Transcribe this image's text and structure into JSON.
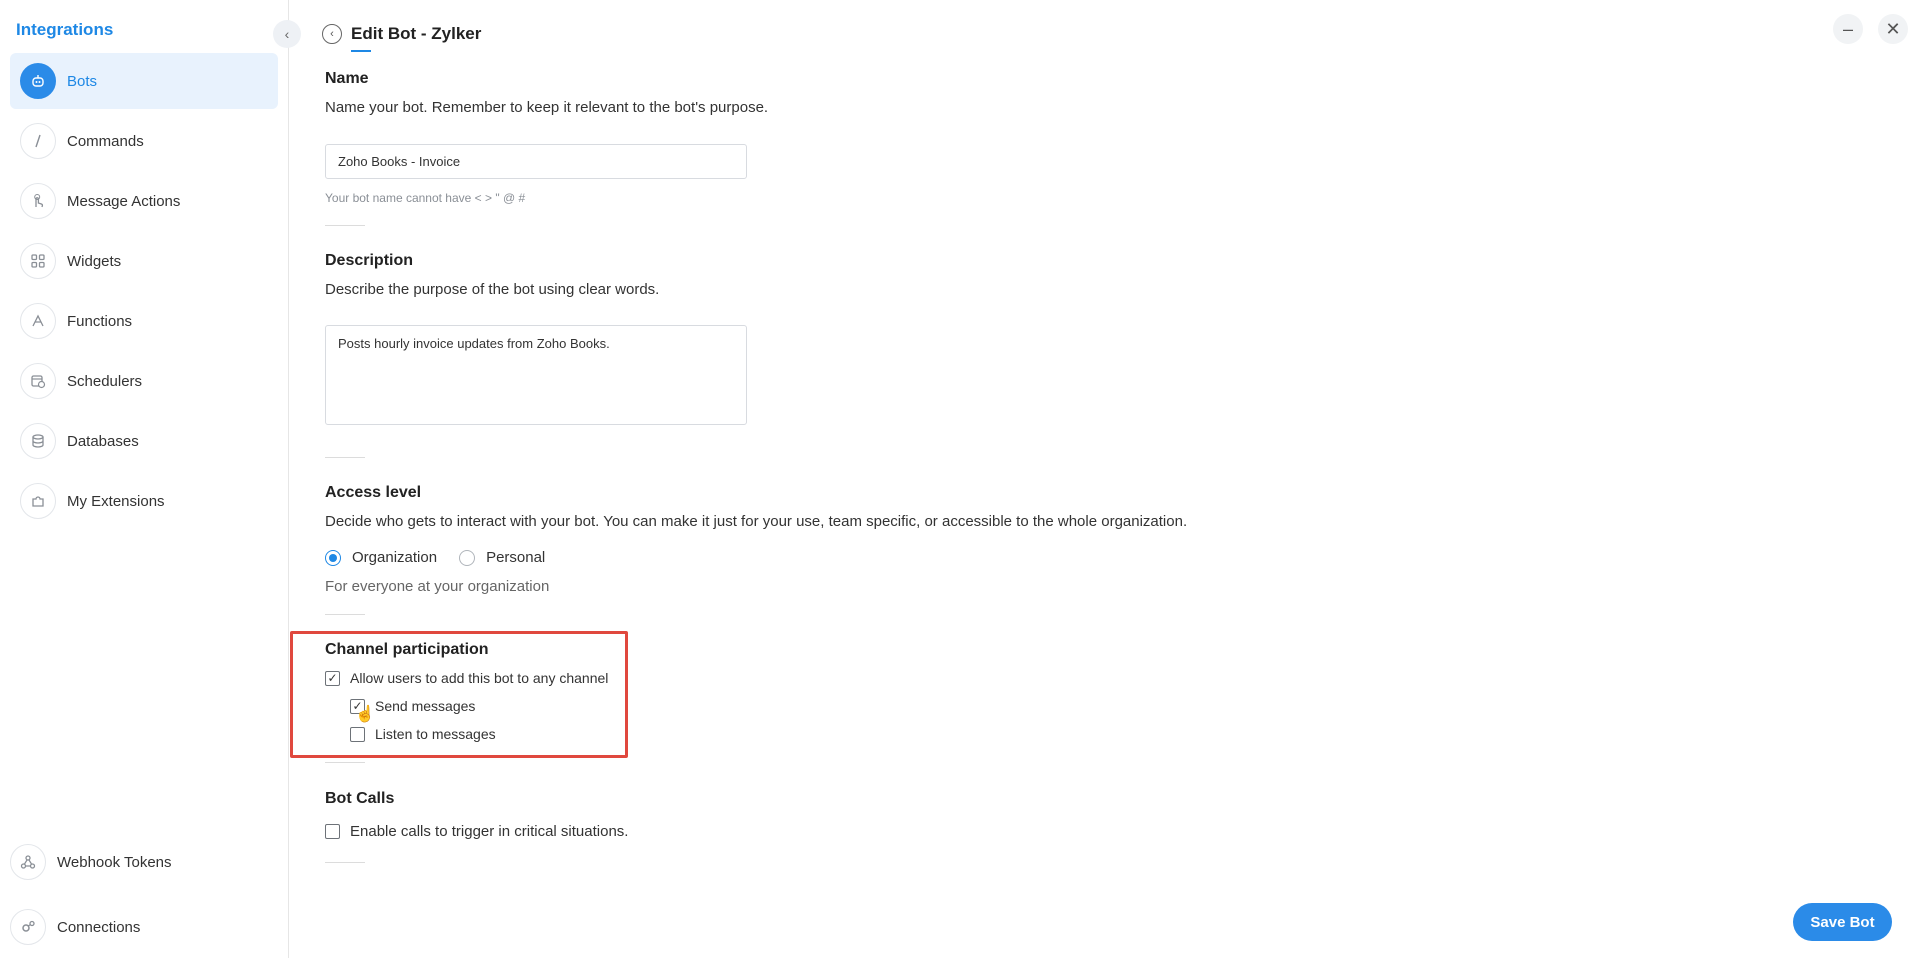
{
  "sidebar": {
    "title": "Integrations",
    "items": [
      {
        "label": "Bots",
        "icon": "bot-icon"
      },
      {
        "label": "Commands",
        "icon": "slash-icon"
      },
      {
        "label": "Message Actions",
        "icon": "touch-icon"
      },
      {
        "label": "Widgets",
        "icon": "grid-icon"
      },
      {
        "label": "Functions",
        "icon": "function-icon"
      },
      {
        "label": "Schedulers",
        "icon": "scheduler-icon"
      },
      {
        "label": "Databases",
        "icon": "database-icon"
      },
      {
        "label": "My Extensions",
        "icon": "puzzle-icon"
      }
    ],
    "bottom_items": [
      {
        "label": "Webhook Tokens",
        "icon": "webhook-icon"
      },
      {
        "label": "Connections",
        "icon": "connections-icon"
      }
    ]
  },
  "header": {
    "title": "Edit Bot - Zylker"
  },
  "form": {
    "name": {
      "title": "Name",
      "description": "Name your bot. Remember to keep it relevant to the bot's purpose.",
      "value": "Zoho Books - Invoice",
      "hint": "Your bot name cannot have < > \" @ #"
    },
    "description": {
      "title": "Description",
      "description": "Describe the purpose of the bot using clear words.",
      "value": "Posts hourly invoice updates from Zoho Books."
    },
    "access": {
      "title": "Access level",
      "description": "Decide who gets to interact with your bot. You can make it just for your use, team specific, or accessible to the whole organization.",
      "option_org": "Organization",
      "option_personal": "Personal",
      "selected": "Organization",
      "hint": "For everyone at your organization"
    },
    "channel": {
      "title": "Channel participation",
      "allow_label": "Allow users to add this bot to any channel",
      "allow_checked": true,
      "send_label": "Send messages",
      "send_checked": true,
      "listen_label": "Listen to messages",
      "listen_checked": false
    },
    "calls": {
      "title": "Bot Calls",
      "enable_label": "Enable calls to trigger in critical situations.",
      "enable_checked": false
    }
  },
  "footer": {
    "save_label": "Save Bot"
  },
  "colors": {
    "accent": "#1e88e5",
    "highlight": "#e0483e"
  }
}
